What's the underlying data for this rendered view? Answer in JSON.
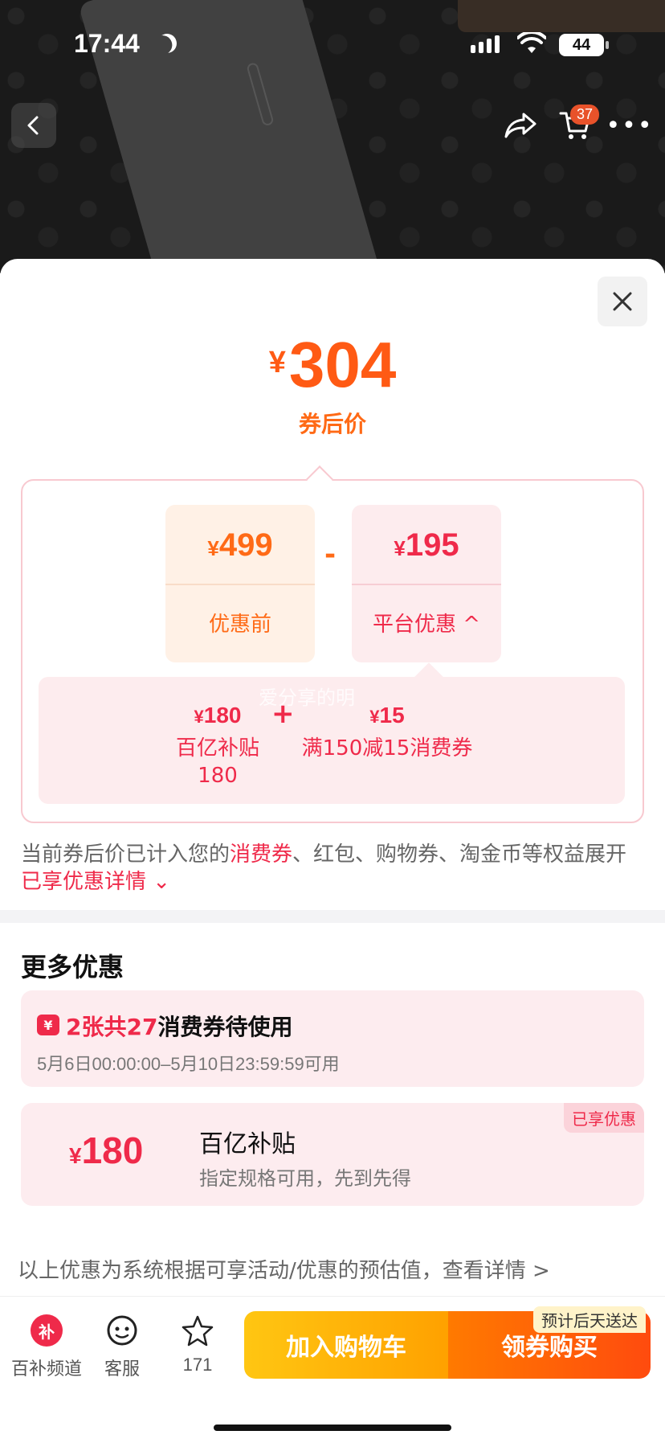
{
  "status_bar": {
    "time": "17:44",
    "battery": "44"
  },
  "header": {
    "cart_count": "37",
    "more_label": "•••"
  },
  "sheet": {
    "price_currency": "¥",
    "price_value": "304",
    "price_label": "券后价",
    "before": {
      "currency": "¥",
      "value": "499",
      "label": "优惠前"
    },
    "minus_symbol": "-",
    "platform": {
      "currency": "¥",
      "value": "195",
      "label": "平台优惠 ^"
    },
    "watermark": "爱分享的明",
    "breakdown": [
      {
        "currency": "¥",
        "value": "180",
        "name_line1": "百亿补贴",
        "name_line2": "180"
      },
      {
        "currency": "¥",
        "value": "15",
        "name_line1": "满150减15消费券",
        "name_line2": ""
      }
    ],
    "plus_symbol": "+",
    "note_prefix": "当前券后价已计入您的",
    "note_highlight": "消费券",
    "note_mid": "、红包、购物券、淘金币等权益展开",
    "note_link": "已享优惠详情 ⌄"
  },
  "more_offers": {
    "title": "更多优惠",
    "coupon": {
      "icon_text": "¥",
      "count_text": "2张共27",
      "tail_text": "消费券待使用",
      "validity": "5月6日00:00:00–5月10日23:59:59可用"
    },
    "subsidy": {
      "currency": "¥",
      "amount": "180",
      "title": "百亿补贴",
      "subtitle": "指定规格可用，先到先得",
      "tag": "已享优惠"
    },
    "disclaimer": "以上优惠为系统根据可享活动/优惠的预估值，查看详情 >"
  },
  "bottom_bar": {
    "channel_icon_text": "补",
    "channel_label": "百补频道",
    "service_label": "客服",
    "fav_count": "171",
    "add_cart_label": "加入购物车",
    "buy_label": "领券购买",
    "delivery_tag": "预计后天送达"
  },
  "colors": {
    "accent_orange": "#ff5a14",
    "accent_red": "#ef2a4a",
    "cart_button": "#ffb300",
    "buy_button": "#ff5a0e"
  }
}
